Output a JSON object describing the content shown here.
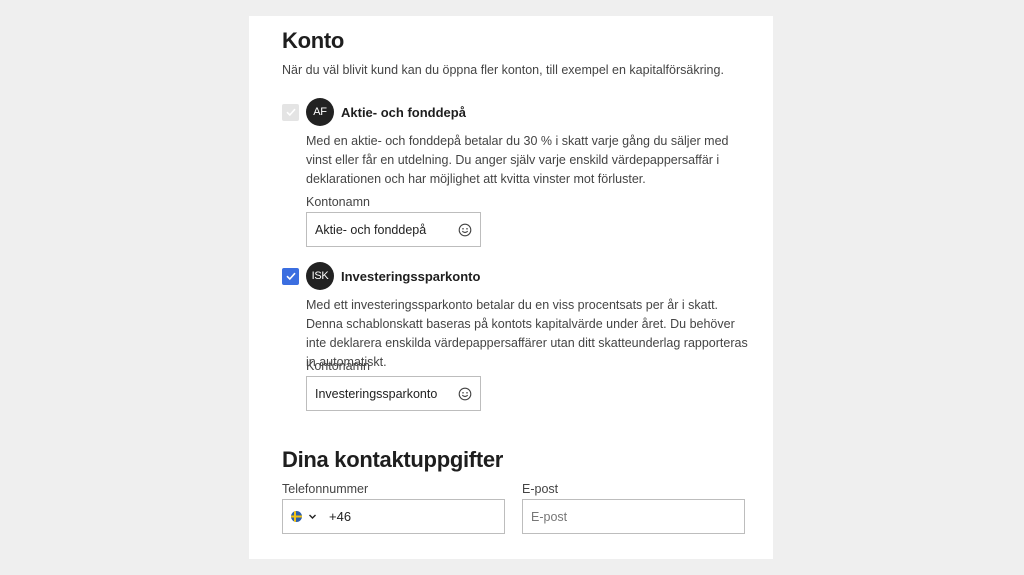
{
  "konto": {
    "title": "Konto",
    "intro": "När du väl blivit kund kan du öppna fler konton, till exempel en kapitalförsäkring."
  },
  "accounts": [
    {
      "badge": "AF",
      "name": "Aktie- och fonddepå",
      "checked": true,
      "disabled": true,
      "description": "Med en aktie- och fonddepå betalar du 30 % i skatt varje gång du säljer med vinst eller får en utdelning. Du anger själv varje enskild värdepappersaffär i deklarationen och har möjlighet att kvitta vinster mot förluster.",
      "field_label": "Kontonamn",
      "field_value": "Aktie- och fonddepå"
    },
    {
      "badge": "ISK",
      "name": "Investeringssparkonto",
      "checked": true,
      "disabled": false,
      "description": "Med ett investeringssparkonto betalar du en viss procentsats per år i skatt. Denna schablonskatt baseras på kontots kapitalvärde under året. Du behöver inte deklarera enskilda värdepappersaffärer utan ditt skatteunderlag rapporteras in automatiskt.",
      "field_label": "Kontonamn",
      "field_value": "Investeringssparkonto"
    }
  ],
  "contact": {
    "title": "Dina kontaktuppgifter",
    "phone_label": "Telefonnummer",
    "phone_country_icon": "sweden-flag-icon",
    "phone_prefix": "+46",
    "email_label": "E-post",
    "email_placeholder": "E-post"
  },
  "colors": {
    "checkbox_checked": "#3b6ee0",
    "checkbox_disabled": "#e4e4e4",
    "badge_bg": "#222222"
  }
}
